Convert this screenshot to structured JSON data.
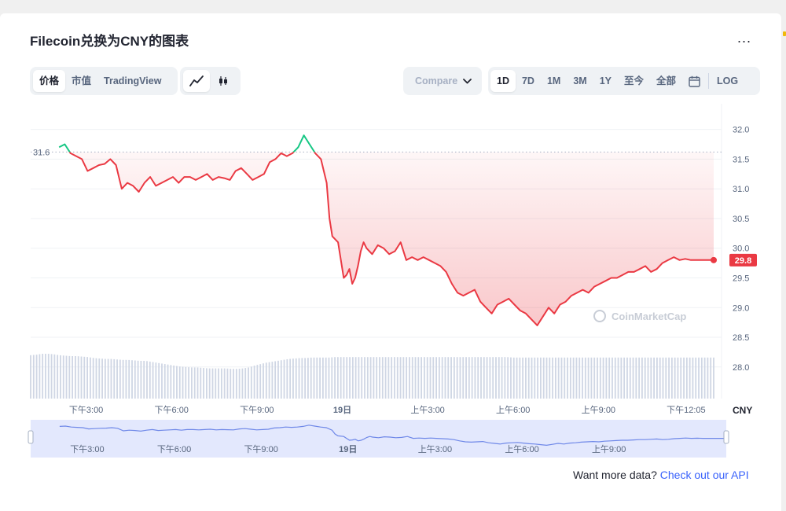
{
  "header": {
    "title": "Filecoin兑换为CNY的图表",
    "more_label": "..."
  },
  "toolbar": {
    "view_tabs": [
      {
        "label": "价格",
        "active": true
      },
      {
        "label": "市值",
        "active": false
      },
      {
        "label": "TradingView",
        "active": false
      }
    ],
    "chart_style_icons": [
      "line-chart-icon",
      "candlestick-icon"
    ],
    "compare_label": "Compare",
    "ranges": [
      {
        "label": "1D",
        "active": true
      },
      {
        "label": "7D",
        "active": false
      },
      {
        "label": "1M",
        "active": false
      },
      {
        "label": "3M",
        "active": false
      },
      {
        "label": "1Y",
        "active": false
      },
      {
        "label": "至今",
        "active": false
      },
      {
        "label": "全部",
        "active": false
      }
    ],
    "calendar_icon": "calendar-icon",
    "log_label": "LOG"
  },
  "colors": {
    "up": "#16c784",
    "down": "#ea3943",
    "volume": "#cfd6e4",
    "navigator_fill": "#e3e8fd",
    "navigator_line": "#3861fb"
  },
  "chart_data": {
    "type": "line",
    "currency_label": "CNY",
    "watermark": "CoinMarketCap",
    "open_label": "31.6",
    "last_label": "29.8",
    "y_ticks": [
      28.0,
      28.5,
      29.0,
      29.5,
      30.0,
      30.5,
      31.0,
      31.5,
      32.0
    ],
    "ylim": [
      27.6,
      32.3
    ],
    "x_ticks": [
      "下午3:00",
      "下午6:00",
      "下午9:00",
      "19日",
      "上午3:00",
      "上午6:00",
      "上午9:00",
      "下午12:05"
    ],
    "xlim": [
      0,
      24
    ],
    "x_tick_positions": [
      1.95,
      4.95,
      7.95,
      10.95,
      13.95,
      16.95,
      19.95,
      23.03
    ],
    "open_price": 31.62,
    "last_price": 29.8,
    "x": [
      1.0,
      1.2,
      1.4,
      1.6,
      1.8,
      2.0,
      2.2,
      2.4,
      2.6,
      2.8,
      3.0,
      3.2,
      3.4,
      3.6,
      3.8,
      4.0,
      4.2,
      4.4,
      4.6,
      4.8,
      5.0,
      5.2,
      5.4,
      5.6,
      5.8,
      6.0,
      6.2,
      6.4,
      6.6,
      6.8,
      7.0,
      7.2,
      7.4,
      7.6,
      7.8,
      8.0,
      8.2,
      8.4,
      8.6,
      8.8,
      9.0,
      9.2,
      9.4,
      9.6,
      9.8,
      10.0,
      10.2,
      10.4,
      10.5,
      10.6,
      10.8,
      11.0,
      11.1,
      11.2,
      11.3,
      11.4,
      11.5,
      11.6,
      11.7,
      11.8,
      12.0,
      12.2,
      12.4,
      12.6,
      12.8,
      13.0,
      13.2,
      13.4,
      13.6,
      13.8,
      14.0,
      14.2,
      14.4,
      14.6,
      14.8,
      15.0,
      15.2,
      15.4,
      15.6,
      15.8,
      16.0,
      16.2,
      16.4,
      16.6,
      16.8,
      17.0,
      17.2,
      17.4,
      17.6,
      17.8,
      18.0,
      18.2,
      18.4,
      18.6,
      18.8,
      19.0,
      19.2,
      19.4,
      19.6,
      19.8,
      20.0,
      20.2,
      20.4,
      20.6,
      20.8,
      21.0,
      21.2,
      21.4,
      21.6,
      21.8,
      22.0,
      22.2,
      22.4,
      22.6,
      22.8,
      23.0,
      23.2,
      23.4,
      23.8,
      24.0
    ],
    "y": [
      31.7,
      31.75,
      31.6,
      31.55,
      31.5,
      31.3,
      31.35,
      31.4,
      31.42,
      31.5,
      31.4,
      31.0,
      31.1,
      31.05,
      30.95,
      31.1,
      31.2,
      31.05,
      31.1,
      31.15,
      31.2,
      31.1,
      31.2,
      31.2,
      31.15,
      31.2,
      31.25,
      31.15,
      31.2,
      31.18,
      31.15,
      31.3,
      31.35,
      31.25,
      31.15,
      31.2,
      31.25,
      31.45,
      31.5,
      31.6,
      31.55,
      31.6,
      31.7,
      31.9,
      31.75,
      31.6,
      31.5,
      31.1,
      30.5,
      30.2,
      30.1,
      29.5,
      29.55,
      29.65,
      29.4,
      29.5,
      29.7,
      29.95,
      30.1,
      30.0,
      29.9,
      30.05,
      30.0,
      29.9,
      29.95,
      30.1,
      29.8,
      29.85,
      29.8,
      29.85,
      29.8,
      29.75,
      29.7,
      29.6,
      29.4,
      29.25,
      29.2,
      29.25,
      29.3,
      29.1,
      29.0,
      28.9,
      29.05,
      29.1,
      29.15,
      29.05,
      28.95,
      28.9,
      28.8,
      28.7,
      28.85,
      29.0,
      28.9,
      29.05,
      29.1,
      29.2,
      29.25,
      29.3,
      29.25,
      29.35,
      29.4,
      29.45,
      29.5,
      29.5,
      29.55,
      29.6,
      29.6,
      29.65,
      29.7,
      29.6,
      29.65,
      29.75,
      29.8,
      29.85,
      29.8,
      29.82,
      29.8,
      29.8,
      29.8,
      29.8
    ],
    "volume_level": [
      0.92,
      0.93,
      0.95,
      0.95,
      0.94,
      0.92,
      0.91,
      0.9,
      0.9,
      0.89,
      0.88,
      0.86,
      0.85,
      0.84,
      0.84,
      0.83,
      0.82,
      0.82,
      0.81,
      0.8,
      0.8,
      0.78,
      0.76,
      0.74,
      0.72,
      0.7,
      0.68,
      0.67,
      0.66,
      0.66,
      0.65,
      0.64,
      0.64,
      0.64,
      0.64,
      0.63,
      0.63,
      0.64,
      0.66,
      0.7,
      0.73,
      0.76,
      0.78,
      0.8,
      0.82,
      0.84,
      0.85,
      0.86,
      0.86,
      0.87,
      0.87,
      0.87,
      0.87,
      0.88,
      0.88,
      0.88,
      0.88,
      0.88,
      0.88,
      0.88,
      0.88,
      0.88,
      0.88,
      0.88,
      0.88,
      0.88,
      0.88,
      0.88,
      0.88,
      0.88,
      0.88,
      0.88,
      0.88,
      0.88,
      0.88,
      0.88,
      0.88,
      0.88,
      0.88,
      0.88,
      0.88,
      0.88,
      0.88,
      0.88,
      0.87,
      0.87,
      0.87,
      0.87,
      0.87,
      0.87,
      0.87,
      0.87,
      0.87,
      0.87,
      0.87,
      0.87,
      0.87,
      0.87,
      0.87,
      0.87,
      0.87,
      0.87,
      0.87,
      0.87,
      0.87,
      0.87,
      0.87,
      0.87,
      0.87,
      0.87,
      0.87,
      0.87,
      0.87,
      0.87,
      0.87,
      0.87,
      0.87,
      0.87,
      0.87,
      0.87
    ],
    "navigator_x_ticks": [
      "下午3:00",
      "下午6:00",
      "下午9:00",
      "19日",
      "上午3:00",
      "上午6:00",
      "上午9:00"
    ],
    "grid": true
  },
  "footer": {
    "prompt": "Want more data?",
    "link": "Check out our API"
  }
}
